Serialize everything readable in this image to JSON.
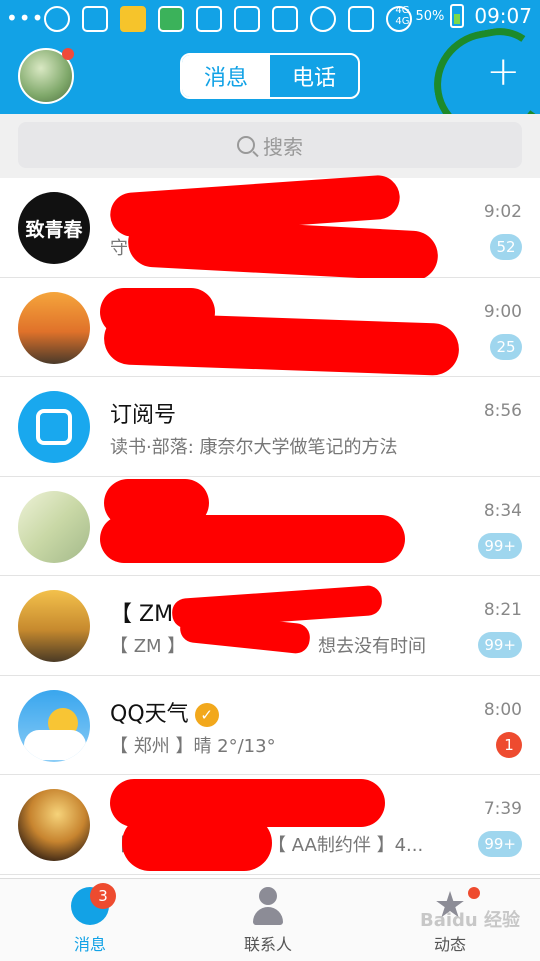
{
  "status_bar": {
    "dots": "•••",
    "network_top": "4G",
    "network_bottom": "4G",
    "battery": "50%",
    "time": "09:07"
  },
  "header": {
    "tab_messages": "消息",
    "tab_calls": "电话",
    "add_icon": "plus-icon",
    "accent_color": "#12a2e6"
  },
  "search": {
    "placeholder": "搜索"
  },
  "conversations": [
    {
      "title": "",
      "subtitle": "守",
      "time": "9:02",
      "badge": "52",
      "avatar_text": "致青春"
    },
    {
      "title": "",
      "subtitle": "",
      "time": "9:00",
      "badge": "25"
    },
    {
      "title": "订阅号",
      "subtitle": "读书·部落: 康奈尔大学做笔记的方法",
      "time": "8:56",
      "badge": ""
    },
    {
      "title": "",
      "subtitle": "",
      "time": "8:34",
      "badge": "99+"
    },
    {
      "title": "【 ZM",
      "subtitle": "【 ZM 】",
      "subtitle_end": "想去没有时间",
      "time": "8:21",
      "badge": "99+"
    },
    {
      "title": "QQ天气",
      "subtitle": "【 郑州 】晴 2°/13°",
      "time": "8:00",
      "badge": "1"
    },
    {
      "title": "",
      "subtitle": "【",
      "subtitle_end": "【 AA制约伴 】4...",
      "time": "7:39",
      "badge": "99+"
    }
  ],
  "tabbar": {
    "messages": "消息",
    "messages_badge": "3",
    "contacts": "联系人",
    "moments": "动态"
  },
  "watermark": "Baidu 经验"
}
